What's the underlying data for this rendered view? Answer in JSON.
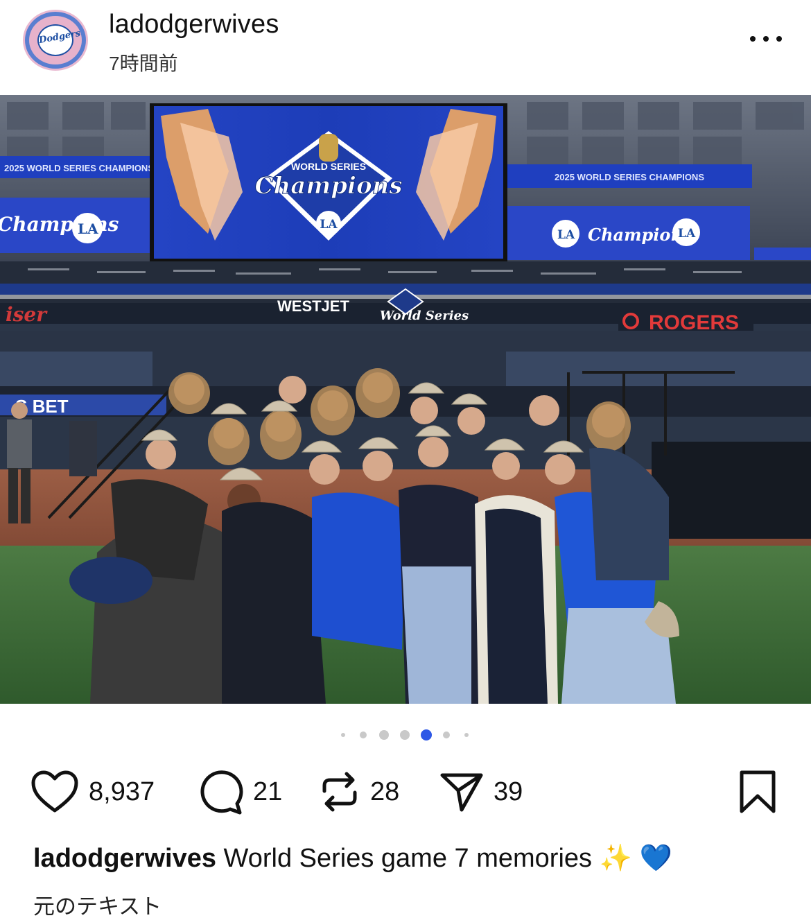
{
  "post": {
    "username": "ladodgerwives",
    "timestamp": "7時間前",
    "avatar_text": "Dodgers"
  },
  "photo": {
    "scoreboard_title_top": "WORLD SERIES",
    "scoreboard_title_main": "Champions",
    "scoreboard_side_text": "2025 WORLD SERIES CHAMPIONS",
    "sponsor_left": "WESTJET",
    "sponsor_center": "World Series",
    "sponsor_right": "ROGERS",
    "team_mark": "LA"
  },
  "carousel": {
    "count": 7,
    "active_index": 4
  },
  "actions": {
    "likes": "8,937",
    "comments": "21",
    "reposts": "28",
    "shares": "39"
  },
  "caption": {
    "username": "ladodgerwives",
    "text": "World Series game 7 memories",
    "emoji_sparkles": "✨",
    "emoji_heart": "💙",
    "translate_label": "元のテキスト"
  },
  "colors": {
    "scoreboard_blue": "#1f3fbf",
    "dodger_blue": "#1e4fa3",
    "active_dot": "#2e58e6",
    "grass": "#3f6a3a"
  },
  "icons": [
    "more-icon",
    "heart-icon",
    "comment-icon",
    "repost-icon",
    "share-icon",
    "bookmark-icon"
  ]
}
